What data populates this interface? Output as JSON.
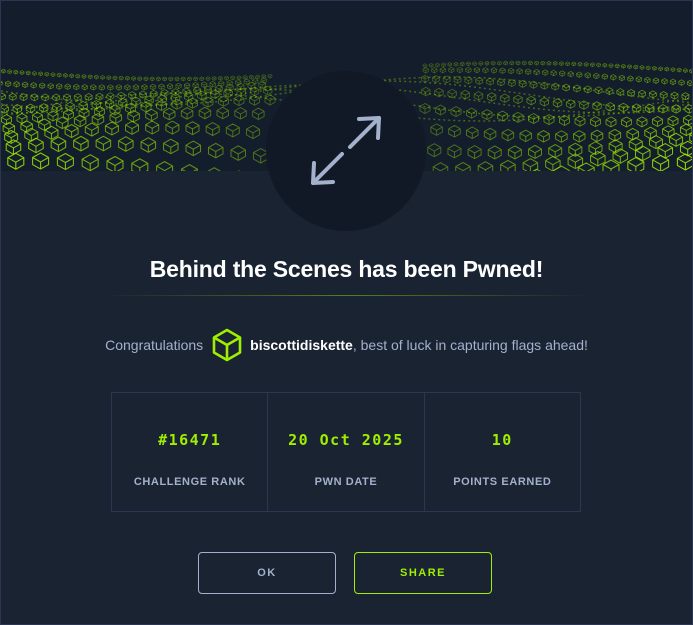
{
  "modal": {
    "title": "Behind the Scenes has been Pwned!",
    "congrats": {
      "prefix": "Congratulations",
      "username": "biscottidiskette",
      "suffix": ", best of luck in capturing flags ahead!"
    },
    "stats": [
      {
        "value": "#16471",
        "label": "CHALLENGE RANK"
      },
      {
        "value": "20 Oct 2025",
        "label": "PWN DATE"
      },
      {
        "value": "10",
        "label": "POINTS EARNED"
      }
    ],
    "buttons": {
      "ok": "OK",
      "share": "SHARE"
    }
  },
  "icons": {
    "emblem": "arrows-expand-icon",
    "avatar": "green-cube-icon"
  },
  "colors": {
    "accent": "#9fef00",
    "background": "#1a2332",
    "panel": "#141d2b",
    "muted_text": "#a4b1cd",
    "border": "#2b3650"
  }
}
